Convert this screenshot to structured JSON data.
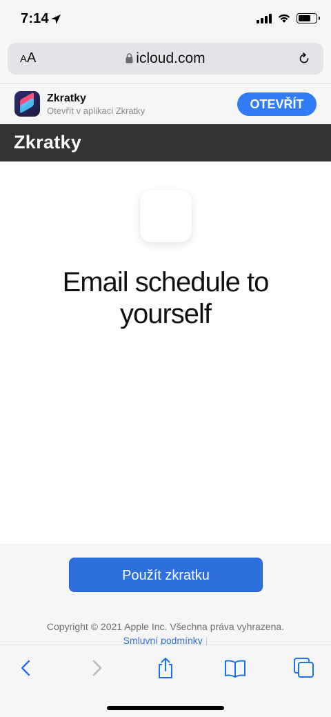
{
  "status_bar": {
    "time": "7:14",
    "icons": [
      "location-arrow-icon",
      "cellular-signal-icon",
      "wifi-icon",
      "battery-icon"
    ]
  },
  "address_bar": {
    "text_size_label_small": "A",
    "text_size_label_large": "A",
    "url": "icloud.com",
    "icons": [
      "lock-icon",
      "reload-icon"
    ]
  },
  "smart_banner": {
    "app_name": "Zkratky",
    "subtitle": "Otevřít v aplikaci Zkratky",
    "open_label": "OTEVŘÍT",
    "accent_color": "#2f7cf6"
  },
  "site_header": {
    "title": "Zkratky",
    "background": "#323232"
  },
  "content": {
    "shortcut_name": "Email schedule to yourself"
  },
  "footer": {
    "use_button_label": "Použít zkratku",
    "copyright_text": "Copyright © 2021 Apple Inc. Všechna práva vyhrazena.",
    "terms_link": "Smluvní podmínky",
    "separator": "|",
    "button_color": "#2d6fdc"
  },
  "toolbar": {
    "icons": [
      "back-icon",
      "forward-icon",
      "share-icon",
      "bookmarks-icon",
      "tabs-icon"
    ],
    "accent_color": "#1a73e8"
  }
}
